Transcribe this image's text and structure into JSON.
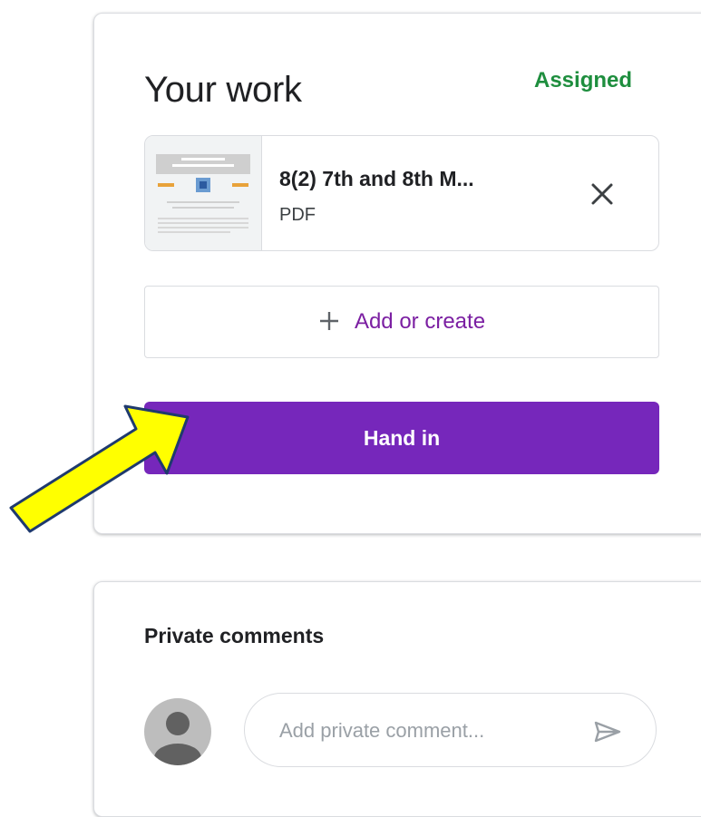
{
  "your_work": {
    "title": "Your work",
    "status": "Assigned",
    "attachment": {
      "name": "8(2) 7th and 8th M...",
      "type": "PDF",
      "thumbnail_icon": "pdf-thumbnail",
      "remove_icon": "close-icon"
    },
    "add_or_create": {
      "icon": "plus-icon",
      "label": "Add or create"
    },
    "hand_in_label": "Hand in"
  },
  "private_comments": {
    "title": "Private comments",
    "avatar_icon": "avatar-icon",
    "input_placeholder": "Add private comment...",
    "send_icon": "send-icon"
  },
  "annotation": {
    "arrow_color": "#ffff00",
    "arrow_outline": "#1f3a6e"
  },
  "colors": {
    "accent_purple": "#7627bb",
    "status_green": "#1e8e3e",
    "border": "#dadce0"
  }
}
